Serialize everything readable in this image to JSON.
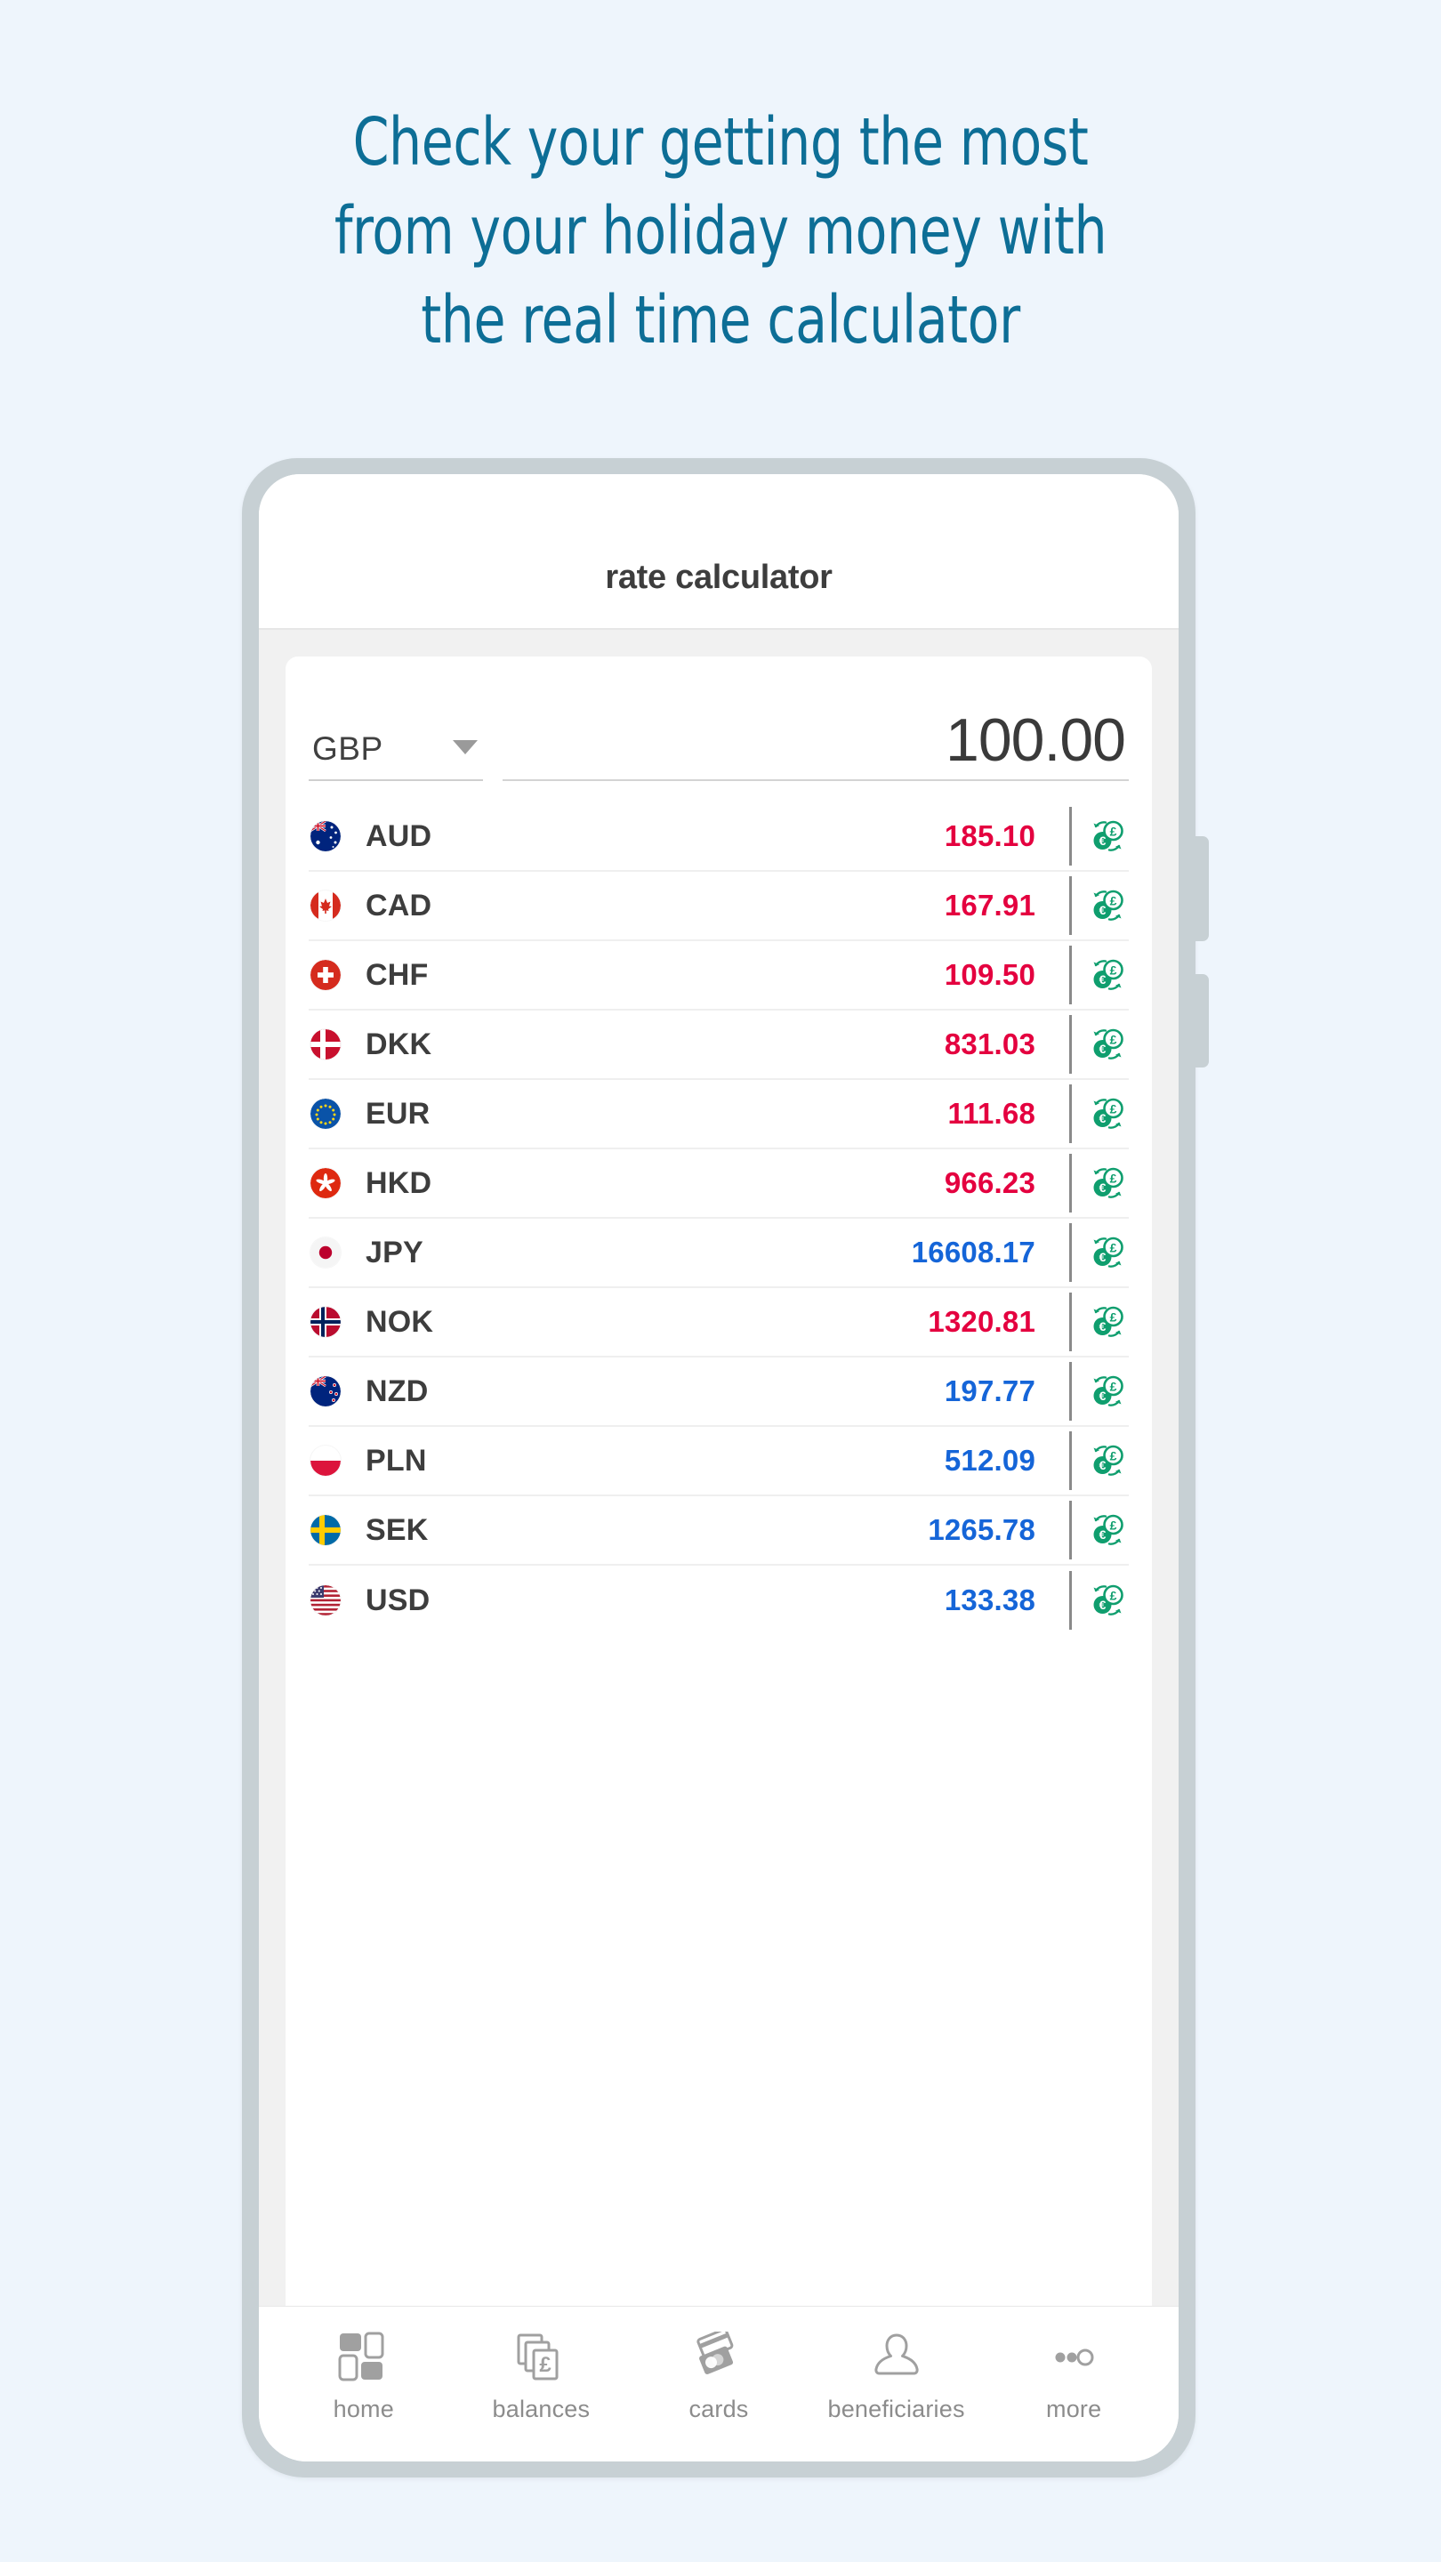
{
  "headline": {
    "lines": [
      "Check your getting the most",
      "from your holiday money with",
      "the real time calculator"
    ],
    "color": "#0d6e96"
  },
  "phone": {
    "app_title": "rate calculator",
    "side_buttons": [
      "volume-button",
      "power-button"
    ]
  },
  "calculator": {
    "base_currency": "GBP",
    "base_currency_caret": "chevron-down-icon",
    "amount_value": "100.00",
    "amount_placeholder": "0.00"
  },
  "colors": {
    "page_background": "#eef5fc",
    "headline_teal": "#0d6e96",
    "rate_down": "#e4003f",
    "rate_up": "#1565d8",
    "fx_icon_green": "#0f9e6e",
    "phone_frame": "#c7d0d4",
    "label_dark": "#3d3d3d",
    "nav_gray": "#8c8c8c"
  },
  "rates": {
    "columns": [
      "flag",
      "currency",
      "rate",
      "exchange"
    ],
    "rows": [
      {
        "code": "AUD",
        "rate": "185.10",
        "direction": "down",
        "flag": "flag-au-icon"
      },
      {
        "code": "CAD",
        "rate": "167.91",
        "direction": "down",
        "flag": "flag-ca-icon"
      },
      {
        "code": "CHF",
        "rate": "109.50",
        "direction": "down",
        "flag": "flag-ch-icon"
      },
      {
        "code": "DKK",
        "rate": "831.03",
        "direction": "down",
        "flag": "flag-dk-icon"
      },
      {
        "code": "EUR",
        "rate": "111.68",
        "direction": "down",
        "flag": "flag-eu-icon"
      },
      {
        "code": "HKD",
        "rate": "966.23",
        "direction": "down",
        "flag": "flag-hk-icon"
      },
      {
        "code": "JPY",
        "rate": "16608.17",
        "direction": "up",
        "flag": "flag-jp-icon"
      },
      {
        "code": "NOK",
        "rate": "1320.81",
        "direction": "down",
        "flag": "flag-no-icon"
      },
      {
        "code": "NZD",
        "rate": "197.77",
        "direction": "up",
        "flag": "flag-nz-icon"
      },
      {
        "code": "PLN",
        "rate": "512.09",
        "direction": "up",
        "flag": "flag-pl-icon"
      },
      {
        "code": "SEK",
        "rate": "1265.78",
        "direction": "up",
        "flag": "flag-se-icon"
      },
      {
        "code": "USD",
        "rate": "133.38",
        "direction": "up",
        "flag": "flag-us-icon"
      }
    ]
  },
  "bottom_nav": {
    "items": [
      {
        "label": "home",
        "icon": "grid-squares-icon"
      },
      {
        "label": "balances",
        "icon": "banknotes-pound-icon"
      },
      {
        "label": "cards",
        "icon": "payment-cards-icon"
      },
      {
        "label": "beneficiaries",
        "icon": "person-icon"
      },
      {
        "label": "more",
        "icon": "three-dots-icon"
      }
    ]
  }
}
